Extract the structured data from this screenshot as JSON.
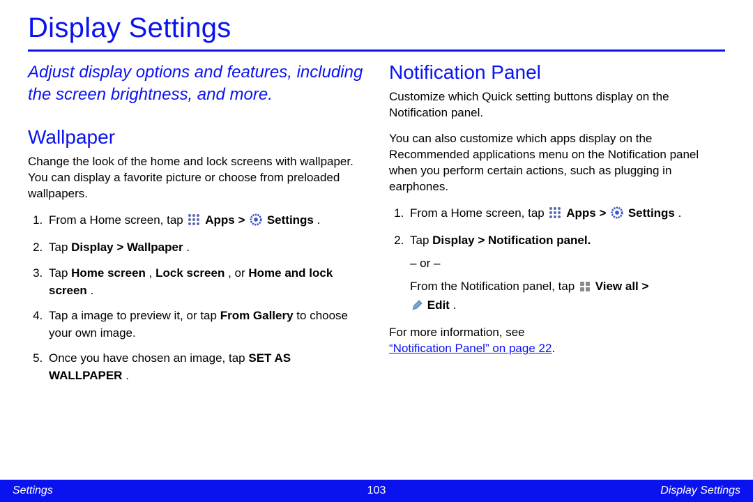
{
  "title": "Display Settings",
  "intro": "Adjust display options and features, including the screen brightness, and more.",
  "left": {
    "heading": "Wallpaper",
    "para": "Change the look of the home and lock screens with wallpaper. You can display a favorite picture or choose from preloaded wallpapers.",
    "s1_a": "From a Home screen, tap ",
    "s1_b": "Apps",
    "s1_c": " > ",
    "s1_d": "Settings",
    "s1_e": ".",
    "s2_a": "Tap ",
    "s2_b": "Display > Wallpaper",
    "s2_c": ".",
    "s3_a": "Tap ",
    "s3_b": "Home screen",
    "s3_c": ", ",
    "s3_d": "Lock screen",
    "s3_e": ", or ",
    "s3_f": "Home and lock screen",
    "s3_g": ".",
    "s4_a": "Tap a image to preview it, or tap ",
    "s4_b": "From Gallery",
    "s4_c": " to choose your own image.",
    "s5_a": " Once you have chosen an image, tap ",
    "s5_b": "SET AS WALLPAPER",
    "s5_c": "."
  },
  "right": {
    "heading": "Notification Panel",
    "para1": "Customize which Quick setting buttons display on the Notification panel.",
    "para2": "You can also customize which apps display on the Recommended applications menu on the Notification panel when you perform certain actions, such as plugging in earphones.",
    "s1_a": "From a Home screen, tap ",
    "s1_b": "Apps",
    "s1_c": " > ",
    "s1_d": "Settings",
    "s1_e": ".",
    "s2_a": "Tap ",
    "s2_b": "Display > Notification panel.",
    "s2_or": "– or –",
    "s2_c": "From the Notification panel, tap ",
    "s2_d": "View all",
    "s2_e": " > ",
    "s2_f": "Edit",
    "s2_g": ".",
    "more_a": "For more information, see ",
    "more_link": "“Notification Panel” on page 22",
    "more_b": "."
  },
  "footer": {
    "left": "Settings",
    "center": "103",
    "right": "Display Settings"
  },
  "icons": {
    "apps": "apps-grid-icon",
    "settings": "settings-gear-icon",
    "tiles": "tiles-icon",
    "edit": "pencil-icon"
  }
}
